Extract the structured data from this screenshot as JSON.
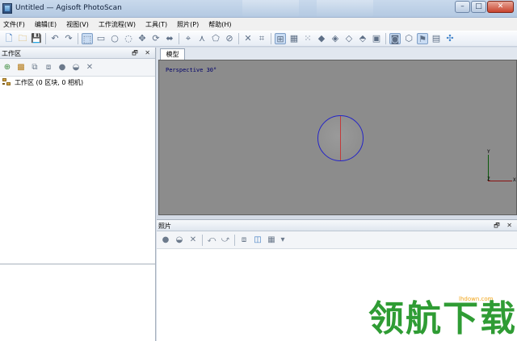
{
  "window": {
    "title": "Untitled — Agisoft PhotoScan",
    "controls": {
      "minimize": "–",
      "maximize": "□",
      "close": "✕"
    }
  },
  "menubar": {
    "items": [
      "文件(F)",
      "编辑(E)",
      "视图(V)",
      "工作流程(W)",
      "工具(T)",
      "照片(P)",
      "帮助(H)"
    ]
  },
  "toolbar": {
    "icons": [
      "new-icon",
      "open-icon",
      "save-icon",
      "undo-icon",
      "redo-icon",
      "select-icon",
      "rect-select-icon",
      "circle-select-icon",
      "free-select-icon",
      "navigation-icon",
      "rotate-object-icon",
      "move-object-icon",
      "ruler-icon",
      "paint-icon",
      "crop-icon",
      "delete-icon",
      "crop-selection-icon",
      "grid-icon",
      "dense-grid-icon",
      "point-cloud-icon",
      "shaded-icon",
      "solid-icon",
      "wireframe-icon",
      "textured-icon",
      "camera-icon",
      "show-cameras-icon",
      "show-region-icon",
      "markers-icon",
      "axes-icon"
    ]
  },
  "workspace": {
    "panel_title": "工作区",
    "panel_controls": "🗗 ✕",
    "tree_root": "工作区 (0 区块, 0 相机)"
  },
  "model": {
    "tab_label": "模型",
    "view_label": "Perspective 30°",
    "axis_y": "Y",
    "axis_x": "X",
    "axis_z": "Z"
  },
  "photos": {
    "panel_title": "照片",
    "panel_controls": "🗗 ✕"
  },
  "watermark": {
    "site": "lhdown.com",
    "text": "领航下载"
  }
}
